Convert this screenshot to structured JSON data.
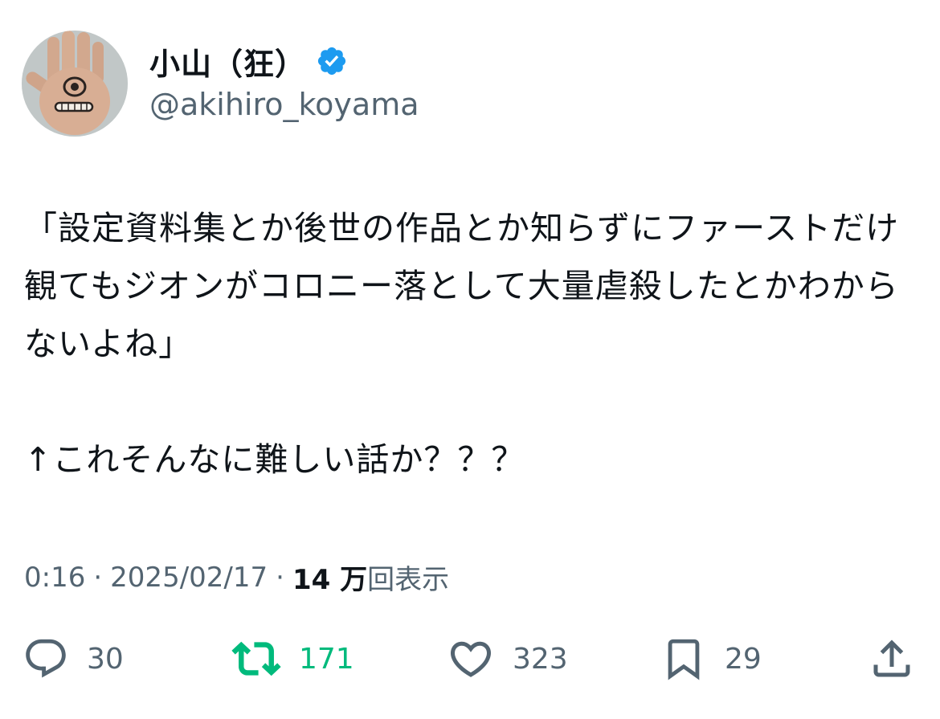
{
  "author": {
    "display_name": "小山（狂）",
    "handle": "@akihiro_koyama",
    "verified": true
  },
  "tweet": {
    "text": "「設定資料集とか後世の作品とか知らずにファーストだけ観てもジオンがコロニー落として大量虐殺したとかわからないよね」\n\n↑これそんなに難しい話か？？？"
  },
  "meta": {
    "time": "0:16",
    "separator": "·",
    "date": "2025/02/17",
    "views_count": "14 万",
    "views_label": "回表示"
  },
  "actions": {
    "reply": {
      "icon": "reply-icon",
      "count": "30"
    },
    "retweet": {
      "icon": "retweet-icon",
      "count": "171",
      "active": true,
      "color": "#00ba7c"
    },
    "like": {
      "icon": "heart-icon",
      "count": "323"
    },
    "bookmark": {
      "icon": "bookmark-icon",
      "count": "29"
    },
    "share": {
      "icon": "share-icon"
    }
  },
  "colors": {
    "text": "#0f1419",
    "secondary": "#536471",
    "verified": "#1d9bf0",
    "retweet_active": "#00ba7c"
  }
}
